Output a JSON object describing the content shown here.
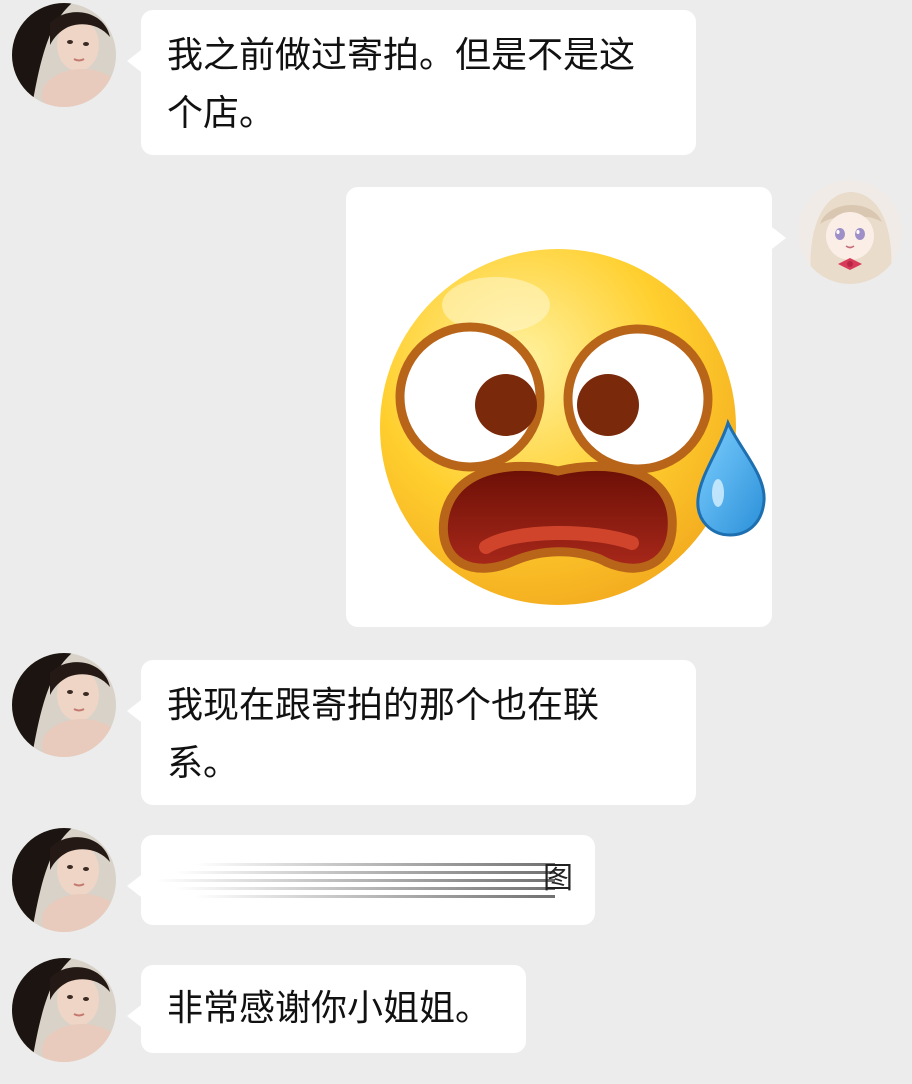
{
  "chat": {
    "messages": [
      {
        "sender": "contact",
        "type": "text",
        "text": "我之前做过寄拍。但是不是这个店。"
      },
      {
        "sender": "self",
        "type": "sticker",
        "sticker": "scared-sweating-face-emoji"
      },
      {
        "sender": "contact",
        "type": "text",
        "text": "我现在跟寄拍的那个也在联系。"
      },
      {
        "sender": "contact",
        "type": "redacted",
        "visible_fragment": "图"
      },
      {
        "sender": "contact",
        "type": "text",
        "text": "非常感谢你小姐姐。"
      }
    ]
  },
  "colors": {
    "background": "#ececec",
    "bubble": "#ffffff",
    "text": "#111111",
    "emoji_face": "#ffcb2e",
    "emoji_outline": "#b8651a",
    "emoji_mouth": "#8a1b0e",
    "sweat_drop": "#3ea8e6"
  },
  "icons": {
    "contact_avatar": "photo-avatar-icon",
    "self_avatar": "anime-girl-avatar-icon"
  }
}
